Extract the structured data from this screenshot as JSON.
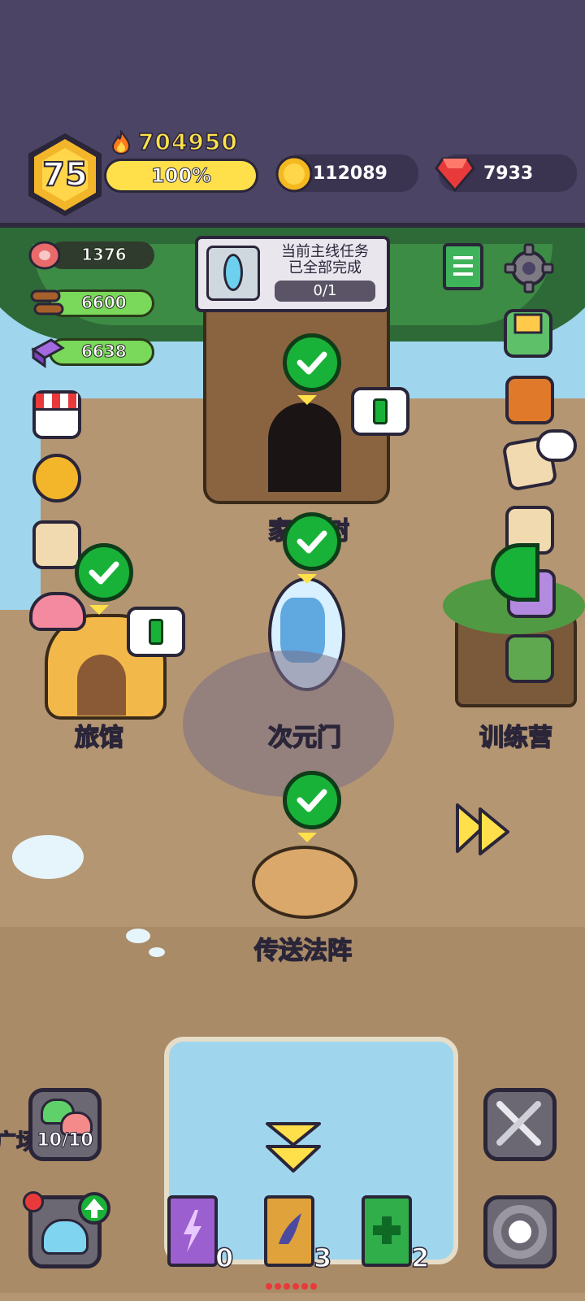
{
  "header": {
    "level": "75",
    "power": "704950",
    "xp_percent": "100%",
    "xp_fraction": 1.0,
    "gold": "112089",
    "gems": "7933"
  },
  "resources": {
    "meat": "1376",
    "wood": "6600",
    "crystal": "6638"
  },
  "quest": {
    "title_line1": "当前主线任务",
    "title_line2": "已全部完成",
    "progress": "0/1"
  },
  "buildings": {
    "tree_label": "家",
    "tree_label_end": "树",
    "inn": "旅馆",
    "portal": "次元门",
    "training": "训练营",
    "teleport": "传送法阵",
    "square": "广场"
  },
  "bottom": {
    "slime_count": "10/10",
    "book1_count": "0",
    "book2_count": "3",
    "book3_count": "2"
  },
  "colors": {
    "bg_top": "#4b4464",
    "xp_yellow": "#ffe04a",
    "check_green": "#19b238",
    "gem_red": "#e83a3a"
  }
}
